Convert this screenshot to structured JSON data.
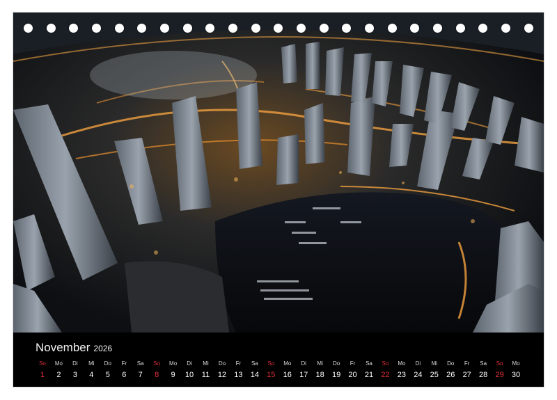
{
  "calendar": {
    "month": "November",
    "year": "2026",
    "days": [
      {
        "wd": "So",
        "dn": "1"
      },
      {
        "wd": "Mo",
        "dn": "2"
      },
      {
        "wd": "Di",
        "dn": "3"
      },
      {
        "wd": "Mi",
        "dn": "4"
      },
      {
        "wd": "Do",
        "dn": "5"
      },
      {
        "wd": "Fr",
        "dn": "6"
      },
      {
        "wd": "Sa",
        "dn": "7"
      },
      {
        "wd": "So",
        "dn": "8"
      },
      {
        "wd": "Mo",
        "dn": "9"
      },
      {
        "wd": "Di",
        "dn": "10"
      },
      {
        "wd": "Mi",
        "dn": "11"
      },
      {
        "wd": "Do",
        "dn": "12"
      },
      {
        "wd": "Fr",
        "dn": "13"
      },
      {
        "wd": "Sa",
        "dn": "14"
      },
      {
        "wd": "So",
        "dn": "15"
      },
      {
        "wd": "Mo",
        "dn": "16"
      },
      {
        "wd": "Di",
        "dn": "17"
      },
      {
        "wd": "Mi",
        "dn": "18"
      },
      {
        "wd": "Do",
        "dn": "19"
      },
      {
        "wd": "Fr",
        "dn": "20"
      },
      {
        "wd": "Sa",
        "dn": "21"
      },
      {
        "wd": "So",
        "dn": "22"
      },
      {
        "wd": "Mo",
        "dn": "23"
      },
      {
        "wd": "Di",
        "dn": "24"
      },
      {
        "wd": "Mi",
        "dn": "25"
      },
      {
        "wd": "Do",
        "dn": "26"
      },
      {
        "wd": "Fr",
        "dn": "27"
      },
      {
        "wd": "Sa",
        "dn": "28"
      },
      {
        "wd": "So",
        "dn": "29"
      },
      {
        "wd": "Mo",
        "dn": "30"
      }
    ],
    "sunday_color": "#e0303a",
    "weekday_color": "#ffffff"
  },
  "photo": {
    "subject": "fisheye-night-city-skyline-with-marina",
    "palette": {
      "sky": "#1a1f26",
      "lights": "#f0a040",
      "water": "#0a0c10",
      "towers": "#8a929c"
    }
  },
  "binding": {
    "hole_count": 23,
    "icon": "ring-binding-holes"
  }
}
